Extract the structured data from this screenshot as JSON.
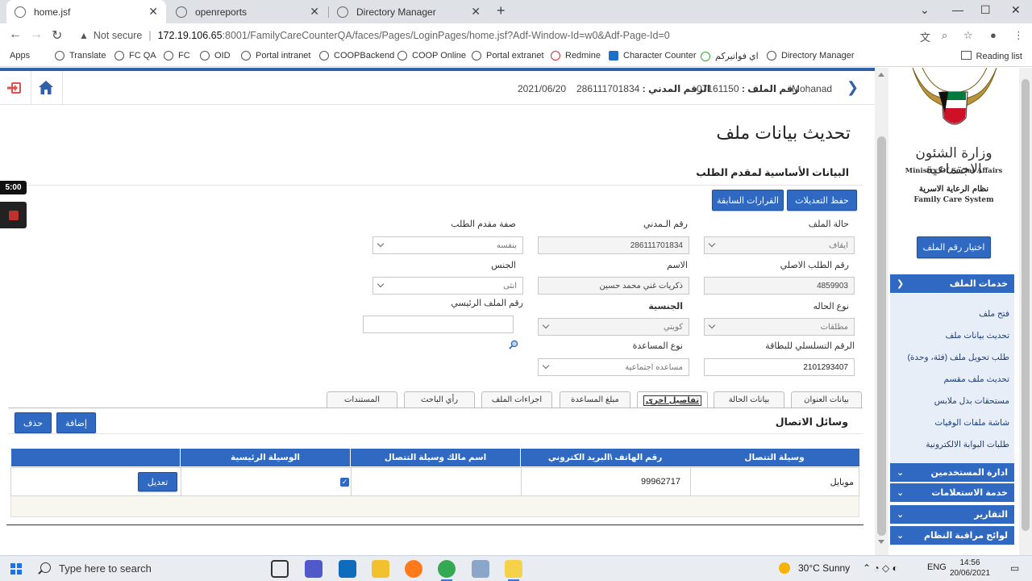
{
  "browser": {
    "tabs": [
      {
        "title": "home.jsf",
        "active": true
      },
      {
        "title": "openreports",
        "active": false
      },
      {
        "title": "Directory Manager",
        "active": false
      }
    ],
    "address": {
      "security": "Not secure",
      "host": "172.19.106.65",
      "path": ":8001/FamilyCareCounterQA/faces/Pages/LoginPages/home.jsf?Adf-Window-Id=w0&Adf-Page-Id=0"
    },
    "bookmarks": [
      "Apps",
      "Translate",
      "FC QA",
      "FC",
      "OID",
      "Portal intranet",
      "COOPBackend",
      "COOP Online",
      "Portal extranet",
      "Redmine",
      "Character Counter",
      "اي فواتيركم",
      "Directory Manager"
    ],
    "reading_list": "Reading list"
  },
  "header": {
    "user": "Mohanad",
    "file_label": "رقم الملف :",
    "file_no": "07161150",
    "civil_label": "الرقم المدني :",
    "civil_no": "286111701834",
    "date": "2021/06/20"
  },
  "page": {
    "title": "تحديث بيانات ملف",
    "section_title": "البيانات الأساسية لمقدم الطلب",
    "buttons": {
      "save": "حفظ التعديلات",
      "prev_decisions": "القرارات السابقة"
    }
  },
  "form": {
    "file_status": {
      "label": "حالة الملف",
      "value": "ايقاف"
    },
    "civil_id": {
      "label": "رقم الـمدني",
      "value": "286111701834"
    },
    "applicant_type": {
      "label": "صفة مقدم الطلب",
      "value": "بنفسه"
    },
    "original_request": {
      "label": "رقم الطلب الاصلي",
      "value": "4859903"
    },
    "name": {
      "label": "الاسم",
      "value": "ذكريات غني محمد حسين"
    },
    "gender": {
      "label": "الجنس",
      "value": "انثى"
    },
    "case_type": {
      "label": "نوع الحاله",
      "value": "مطلقات"
    },
    "nationality": {
      "label": "الجنسية",
      "value": "كويتي"
    },
    "main_file": {
      "label": "رقم الملف الرئيسي",
      "value": ""
    },
    "card_serial": {
      "label": "الرقم التسلسلي للبطاقة",
      "value": "2101293407"
    },
    "aid_type": {
      "label": "نوع المساعدة",
      "value": "مساعده اجتماعية"
    }
  },
  "tabs": [
    "بيانات العنوان",
    "بيانات الحالة",
    "تفاصيل اخرى",
    "مبلغ المساعدة",
    "اجراءات الملف",
    "رأي الباحث",
    "المستندات"
  ],
  "contact": {
    "title": "وسائل الاتصال",
    "add": "إضافة",
    "delete": "حذف",
    "columns": [
      "وسيلة التتصال",
      "رقم الهاتف \\البريد الكتروني",
      "اسم مالك وسيلة التتصال",
      "الوسيلة الرئيسية"
    ],
    "rows": [
      {
        "method": "موبايل",
        "phone": "99962717",
        "owner": "",
        "primary": true,
        "edit": "تعديل"
      }
    ]
  },
  "recorder": {
    "time": "5:00"
  },
  "sidebar": {
    "ministry_ar": "وزارة الشئون الاجتماعية",
    "ministry_en": "Ministry Of Social Affairs",
    "system_ar": "نظام الرعاية الاسرية",
    "system_en": "Family Care System",
    "choose_file": "اختيار رقم الملف",
    "menus": [
      {
        "label": "خدمات الملف",
        "expanded": true,
        "items": [
          "فتح ملف",
          "تحديث بيانات ملف",
          "طلب تحويل ملف (فئة، وحدة)",
          "تحديث ملف مقسم",
          "مستحقات بدل ملابس",
          "شاشة ملفات الوفيات",
          "طلبات البوابة الالكترونية"
        ]
      },
      {
        "label": "ادارة المستخدمين",
        "expanded": false
      },
      {
        "label": "خدمة الاستعلامات",
        "expanded": false
      },
      {
        "label": "التقارير",
        "expanded": false
      },
      {
        "label": "لوائح مراقبة النظام",
        "expanded": false
      }
    ]
  },
  "taskbar": {
    "search": "Type here to search",
    "weather": "30°C  Sunny",
    "lang": "ENG",
    "time": "14:56",
    "date": "20/06/2021"
  },
  "colors": {
    "primary": "#2f69c2",
    "strip": "#2f60a8",
    "menu_bg": "#e8eef8"
  }
}
